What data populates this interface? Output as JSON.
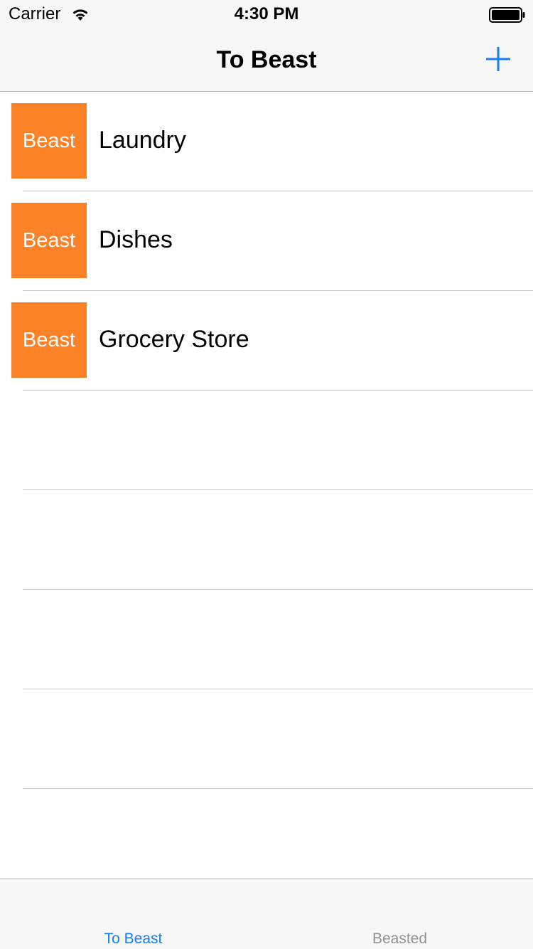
{
  "status_bar": {
    "carrier": "Carrier",
    "time": "4:30 PM",
    "icons": [
      "wifi-icon",
      "battery-icon"
    ]
  },
  "nav": {
    "title": "To Beast",
    "add_icon": "plus-icon"
  },
  "tasks": [
    {
      "button_label": "Beast",
      "name": "Laundry"
    },
    {
      "button_label": "Beast",
      "name": "Dishes"
    },
    {
      "button_label": "Beast",
      "name": "Grocery Store"
    }
  ],
  "tab_bar": {
    "tabs": [
      {
        "label": "To Beast",
        "selected": true
      },
      {
        "label": "Beasted",
        "selected": false
      }
    ]
  },
  "colors": {
    "accent": "#147efb",
    "beast_orange": "#fd8127",
    "tab_inactive": "#929292"
  }
}
